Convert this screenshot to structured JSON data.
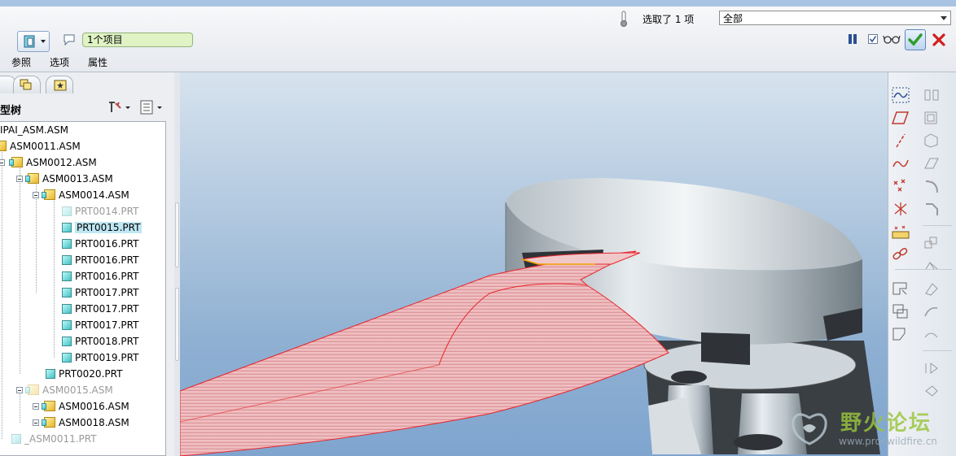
{
  "dashboard": {
    "selection_status": "选取了 1 项",
    "filter_value": "全部",
    "collector_text": "1个项目",
    "tabs": [
      {
        "label": "参照"
      },
      {
        "label": "选项"
      },
      {
        "label": "属性"
      }
    ]
  },
  "model_tree": {
    "title": "型树",
    "items": [
      {
        "label": "IPAI_ASM.ASM",
        "kind": "root",
        "state": "normal"
      },
      {
        "label": "ASM0011.ASM",
        "kind": "asm",
        "state": "normal"
      },
      {
        "label": "ASM0012.ASM",
        "kind": "asm",
        "state": "normal"
      },
      {
        "label": "ASM0013.ASM",
        "kind": "asm",
        "state": "normal"
      },
      {
        "label": "ASM0014.ASM",
        "kind": "asm",
        "state": "normal"
      },
      {
        "label": "PRT0014.PRT",
        "kind": "part",
        "state": "suppressed"
      },
      {
        "label": "PRT0015.PRT",
        "kind": "part",
        "state": "selected"
      },
      {
        "label": "PRT0016.PRT",
        "kind": "part",
        "state": "normal"
      },
      {
        "label": "PRT0016.PRT",
        "kind": "part",
        "state": "normal"
      },
      {
        "label": "PRT0016.PRT",
        "kind": "part",
        "state": "normal"
      },
      {
        "label": "PRT0017.PRT",
        "kind": "part",
        "state": "normal"
      },
      {
        "label": "PRT0017.PRT",
        "kind": "part",
        "state": "normal"
      },
      {
        "label": "PRT0017.PRT",
        "kind": "part",
        "state": "normal"
      },
      {
        "label": "PRT0018.PRT",
        "kind": "part",
        "state": "normal"
      },
      {
        "label": "PRT0019.PRT",
        "kind": "part",
        "state": "normal"
      },
      {
        "label": "PRT0020.PRT",
        "kind": "part",
        "state": "normal"
      },
      {
        "label": "ASM0015.ASM",
        "kind": "asm",
        "state": "suppressed"
      },
      {
        "label": "ASM0016.ASM",
        "kind": "asm",
        "state": "normal"
      },
      {
        "label": "ASM0018.ASM",
        "kind": "asm",
        "state": "normal"
      },
      {
        "label": "_ASM0011.PRT",
        "kind": "part",
        "state": "suppressed"
      }
    ]
  },
  "watermark": {
    "title": "野火论坛",
    "url": "www.proewildfire.cn"
  },
  "colors": {
    "accent": "#2a4f91",
    "selection": "#bfe7f3",
    "collector": "#dff3c4",
    "surface_red": "#e8242a",
    "ok_green": "#2e9e2e",
    "cancel_red": "#d0201e"
  },
  "icons": {
    "toolbar_right": [
      "datum-curve-icon",
      "datum-plane-icon",
      "datum-axis-icon",
      "sketch-curve-icon",
      "datum-point-icon",
      "csys-icon",
      "analysis-icon",
      "chain-link-icon",
      "insert-rectangle-icon",
      "insert-copy-icon",
      "insert-shape-icon"
    ]
  }
}
